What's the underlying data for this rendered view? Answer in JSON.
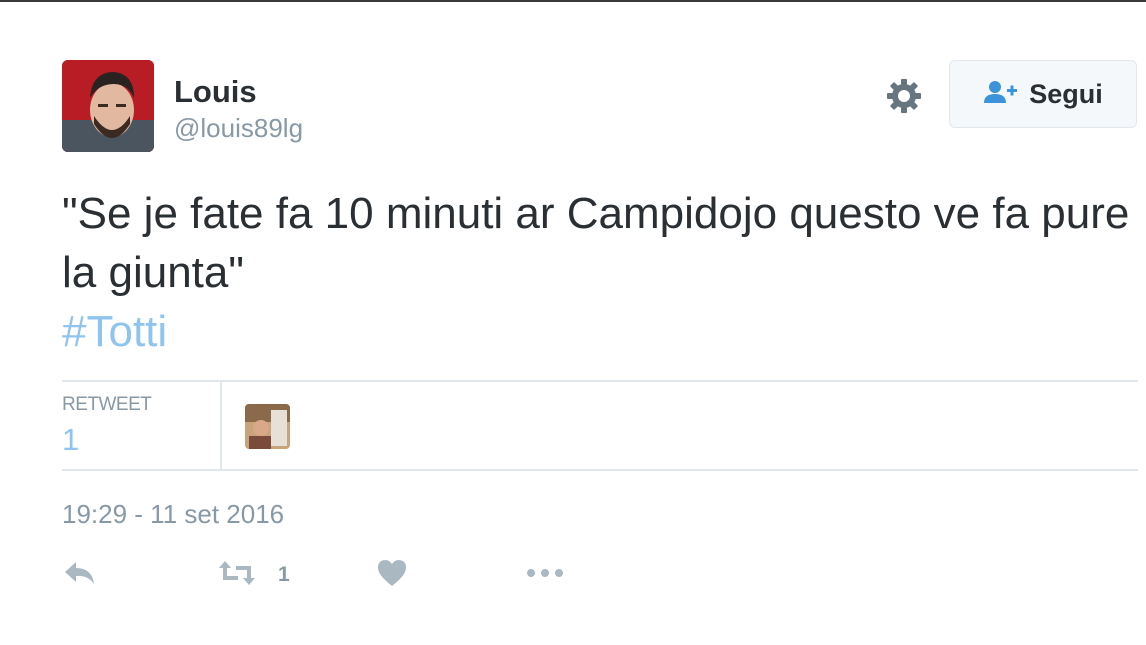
{
  "user": {
    "name": "Louis",
    "handle": "@louis89lg"
  },
  "follow_button": {
    "label": "Segui"
  },
  "tweet": {
    "text": "\"Se je fate fa 10 minuti ar Campidojo questo ve fa pure la giunta\"",
    "hashtag": "#Totti"
  },
  "stats": {
    "retweet_label": "RETWEET",
    "retweet_count": "1"
  },
  "timestamp": "19:29 - 11 set 2016",
  "actions": {
    "retweet_count": "1"
  },
  "colors": {
    "link": "#8ec4ee",
    "icon": "#aab8c2",
    "muted": "#8899a6"
  },
  "icons": [
    "gear-icon",
    "add-user-icon",
    "reply-icon",
    "retweet-icon",
    "heart-icon",
    "more-icon"
  ]
}
